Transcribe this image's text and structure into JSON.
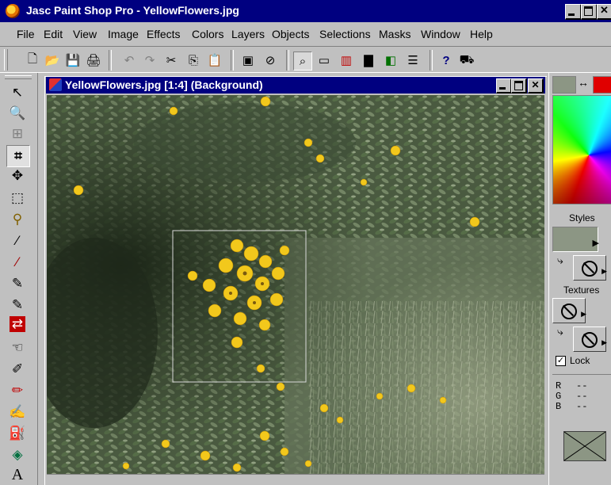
{
  "app": {
    "title": "Jasc Paint Shop Pro - YellowFlowers.jpg",
    "colors": {
      "titlebar": "#000080",
      "chrome": "#c0c0c0",
      "background_swatch": "#8c9684",
      "foreground_swatch": "#e00000"
    }
  },
  "window_controls": {
    "minimize": "minimize",
    "maximize": "maximize",
    "close": "✕"
  },
  "menu": [
    "File",
    "Edit",
    "View",
    "Image",
    "Effects",
    "Colors",
    "Layers",
    "Objects",
    "Selections",
    "Masks",
    "Window",
    "Help"
  ],
  "toolbar": {
    "buttons": [
      {
        "name": "new-icon",
        "glyph": "🗋"
      },
      {
        "name": "open-icon",
        "glyph": "📂"
      },
      {
        "name": "save-icon",
        "glyph": "💾"
      },
      {
        "name": "print-icon",
        "glyph": "🖨"
      },
      {
        "name": "undo-icon",
        "glyph": "↶"
      },
      {
        "name": "redo-icon",
        "glyph": "↷"
      },
      {
        "name": "cut-icon",
        "glyph": "✂"
      },
      {
        "name": "copy-icon",
        "glyph": "⎘"
      },
      {
        "name": "paste-icon",
        "glyph": "📋"
      },
      {
        "name": "browse-icon",
        "glyph": "▣"
      },
      {
        "name": "no-entry-icon",
        "glyph": "⊘"
      },
      {
        "name": "zoom-toggle-icon",
        "glyph": "⌕"
      },
      {
        "name": "toolbar-toggle-icon",
        "glyph": "▭"
      },
      {
        "name": "color-palette-icon",
        "glyph": "▥"
      },
      {
        "name": "histogram-icon",
        "glyph": "▇"
      },
      {
        "name": "layers-icon",
        "glyph": "◧"
      },
      {
        "name": "overview-icon",
        "glyph": "☰"
      },
      {
        "name": "help-icon",
        "glyph": "?"
      },
      {
        "name": "capture-icon",
        "glyph": "⛟"
      }
    ]
  },
  "tools": [
    {
      "name": "arrow-tool-icon",
      "glyph": "↖"
    },
    {
      "name": "zoom-tool-icon",
      "glyph": "🔍"
    },
    {
      "name": "deform-tool-icon",
      "glyph": "⊞"
    },
    {
      "name": "crop-tool-icon",
      "glyph": "⌗"
    },
    {
      "name": "mover-tool-icon",
      "glyph": "✥"
    },
    {
      "name": "selection-tool-icon",
      "glyph": "⬚"
    },
    {
      "name": "freehand-selection-tool-icon",
      "glyph": "⚲"
    },
    {
      "name": "magic-wand-tool-icon",
      "glyph": "⁄"
    },
    {
      "name": "dropper-tool-icon",
      "glyph": "⁄"
    },
    {
      "name": "paintbrush-tool-icon",
      "glyph": "✎"
    },
    {
      "name": "clone-brush-tool-icon",
      "glyph": "✎"
    },
    {
      "name": "color-replacer-tool-icon",
      "glyph": "⇄"
    },
    {
      "name": "retouch-tool-icon",
      "glyph": "☜"
    },
    {
      "name": "scratch-remover-tool-icon",
      "glyph": "✐"
    },
    {
      "name": "eraser-tool-icon",
      "glyph": "✏"
    },
    {
      "name": "picture-tube-tool-icon",
      "glyph": "✍"
    },
    {
      "name": "airbrush-tool-icon",
      "glyph": "⛽"
    },
    {
      "name": "flood-fill-tool-icon",
      "glyph": "◈"
    },
    {
      "name": "text-tool-icon",
      "glyph": "A"
    }
  ],
  "document": {
    "title": "YellowFlowers.jpg [1:4] (Background)"
  },
  "panel": {
    "styles_label": "Styles",
    "textures_label": "Textures",
    "lock_label": "Lock",
    "lock_checked": true,
    "swap_glyph": "↔",
    "rgb": [
      {
        "label": "R",
        "value": "--"
      },
      {
        "label": "G",
        "value": "--"
      },
      {
        "label": "B",
        "value": "--"
      }
    ]
  }
}
